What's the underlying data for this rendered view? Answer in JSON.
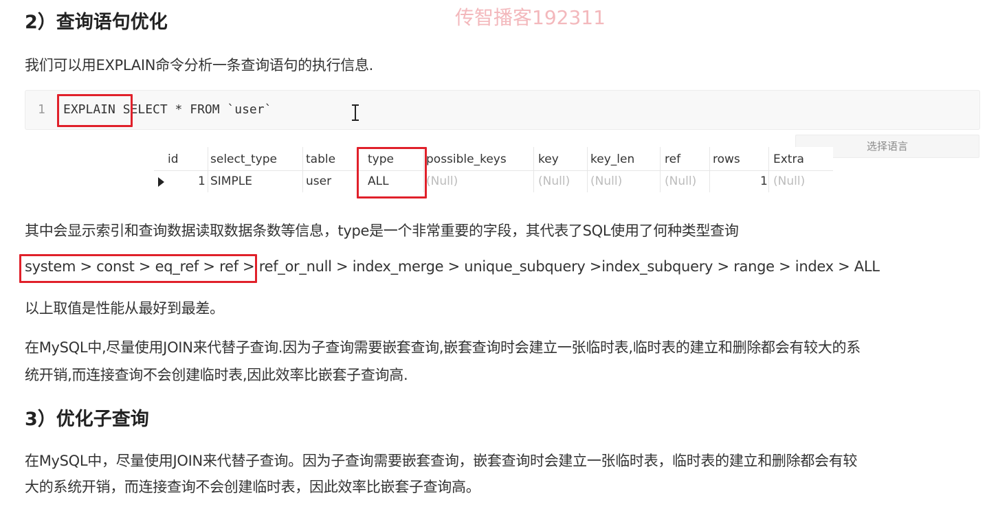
{
  "watermark": "传智播客192311",
  "section2": {
    "heading": "2）查询语句优化",
    "intro": "我们可以用EXPLAIN命令分析一条查询语句的执行信息.",
    "code": {
      "line_number": "1",
      "keyword": "EXPLAIN",
      "rest": " SELECT * FROM `user`"
    },
    "language_select": "选择语言",
    "result_table": {
      "columns": [
        "id",
        "select_type",
        "table",
        "type",
        "possible_keys",
        "key",
        "key_len",
        "ref",
        "rows",
        "Extra"
      ],
      "row": [
        "1",
        "SIMPLE",
        "user",
        "ALL",
        "(Null)",
        "(Null)",
        "(Null)",
        "(Null)",
        "1",
        "(Null)"
      ]
    },
    "para_type": "其中会显示索引和查询数据读取数据条数等信息，type是一个非常重要的字段，其代表了SQL使用了何种类型查询",
    "type_order_highlight": "system > const > eq_ref > ref",
    "type_order_rest": " > ref_or_null > index_merge > unique_subquery >index_subquery > range > index > ALL",
    "para_best_worst": "以上取值是性能从最好到最差。",
    "para_mysql_1": "在MySQL中,尽量使用JOIN来代替子查询.因为子查询需要嵌套查询,嵌套查询时会建立一张临时表,临时表的建立和删除都会有较大的系",
    "para_mysql_2": "统开销,而连接查询不会创建临时表,因此效率比嵌套子查询高."
  },
  "section3": {
    "heading": "3）优化子查询",
    "para_1": "在MySQL中，尽量使用JOIN来代替子查询。因为子查询需要嵌套查询，嵌套查询时会建立一张临时表，临时表的建立和删除都会有较",
    "para_2": "大的系统开销，而连接查询不会创建临时表，因此效率比嵌套子查询高。"
  },
  "colors": {
    "highlight_border": "#e0202a",
    "watermark": "#f3b8bc",
    "null_text": "#bcbcbc"
  }
}
